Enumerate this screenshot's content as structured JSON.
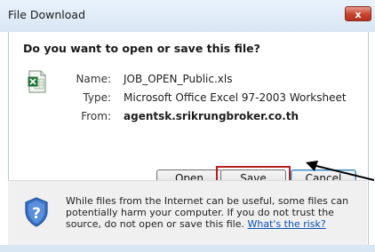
{
  "window": {
    "title": "File Download",
    "close_glyph": "x"
  },
  "dialog": {
    "question": "Do you want to open or save this file?",
    "file_icon": "excel-file-icon",
    "name_label": "Name:",
    "name_value": "JOB_OPEN_Public.xls",
    "type_label": "Type:",
    "type_value": "Microsoft Office Excel 97-2003 Worksheet",
    "from_label": "From:",
    "from_value": "agentsk.srikrungbroker.co.th"
  },
  "buttons": {
    "open_label": "Open",
    "save_label": "Save",
    "cancel_label": "Cancel"
  },
  "footer": {
    "icon": "shield-question-icon",
    "warning_text": "While files from the Internet can be useful, some files can potentially harm your computer. If you do not trust the source, do not open or save this file.",
    "link_text": "What's the risk?"
  },
  "annotations": {
    "highlight_color": "#b5201e",
    "arrow_color": "#000000"
  }
}
